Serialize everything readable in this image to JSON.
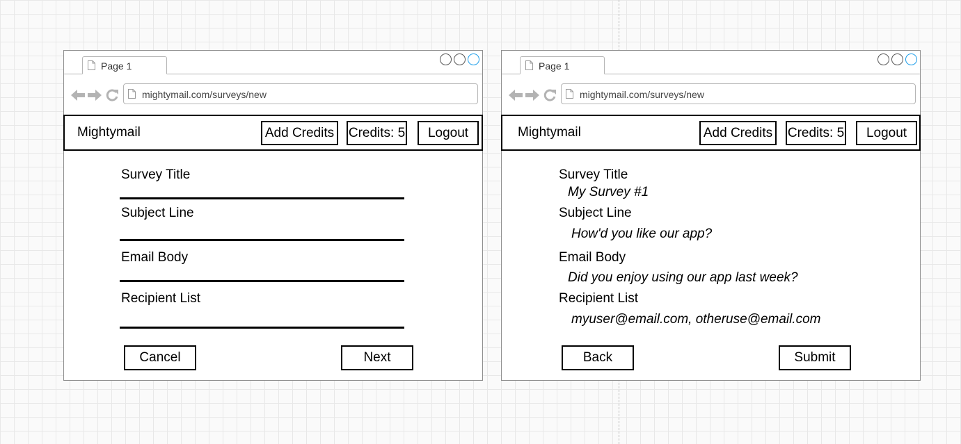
{
  "browser": {
    "tab_label": "Page 1",
    "url": "mightymail.com/surveys/new"
  },
  "header": {
    "brand": "Mightymail",
    "add_credits": "Add Credits",
    "credits": "Credits: 5",
    "logout": "Logout"
  },
  "form": {
    "fields": [
      {
        "label": "Survey Title"
      },
      {
        "label": "Subject Line"
      },
      {
        "label": "Email Body"
      },
      {
        "label": "Recipient List"
      }
    ],
    "cancel": "Cancel",
    "next": "Next"
  },
  "review": {
    "fields": [
      {
        "label": "Survey Title",
        "value": "My Survey #1"
      },
      {
        "label": "Subject Line",
        "value": "How'd you like our app?"
      },
      {
        "label": "Email Body",
        "value": "Did you enjoy using our app last week?"
      },
      {
        "label": "Recipient List",
        "value": "myuser@email.com, otheruse@email.com"
      }
    ],
    "back": "Back",
    "submit": "Submit"
  },
  "colors": {
    "grid": "#e8e8e8",
    "window_border": "#8f8f8f",
    "active_control": "#1e9ee9",
    "nav_icon": "#b3b3b3"
  },
  "icons": [
    "doc-icon",
    "back-arrow-icon",
    "forward-arrow-icon",
    "reload-icon"
  ]
}
